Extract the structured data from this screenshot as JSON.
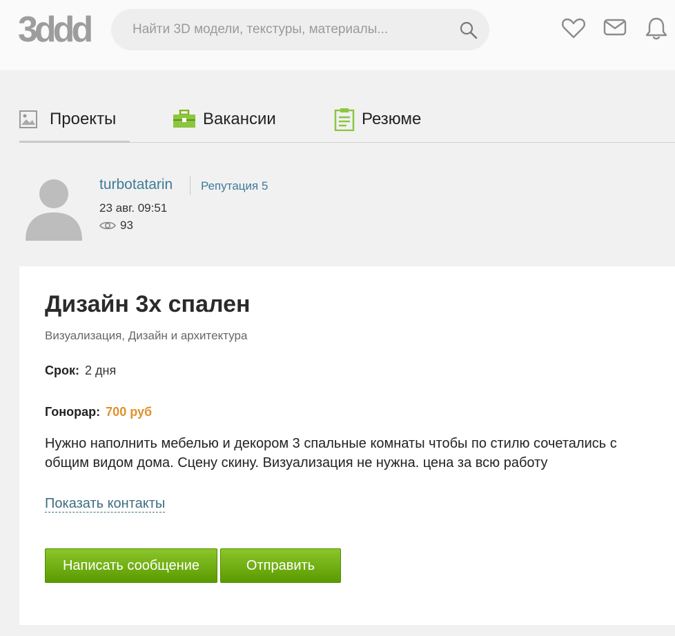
{
  "header": {
    "logo_text": "3ddd",
    "search_placeholder": "Найти 3D модели, текстуры, материалы...",
    "icons": [
      "search-icon",
      "heart-icon",
      "mail-icon",
      "bell-icon"
    ]
  },
  "tabs": [
    {
      "label": "Проекты",
      "icon": "image-icon",
      "active": true
    },
    {
      "label": "Вакансии",
      "icon": "briefcase-icon",
      "active": false
    },
    {
      "label": "Резюме",
      "icon": "clipboard-icon",
      "active": false
    }
  ],
  "author": {
    "username": "turbotatarin",
    "reputation": "Репутация 5",
    "date": "23 авг. 09:51",
    "views": "93"
  },
  "project": {
    "title": "Дизайн 3х спален",
    "category": "Визуализация, Дизайн и архитектура",
    "deadline_label": "Срок:",
    "deadline_value": "2 дня",
    "fee_label": "Гонорар:",
    "fee_value": "700 руб",
    "description": "Нужно наполнить мебелью и декором 3 спальные комнаты чтобы по стилю сочетались с общим видом дома. Сцену скину. Визуализация не нужна. цена за всю работу",
    "show_contacts": "Показать контакты",
    "write_message": "Написать сообщение",
    "send": "Отправить"
  },
  "colors": {
    "accent_green": "#6aab0e",
    "fee_orange": "#e0912a",
    "link_blue": "#3e7a9a"
  }
}
